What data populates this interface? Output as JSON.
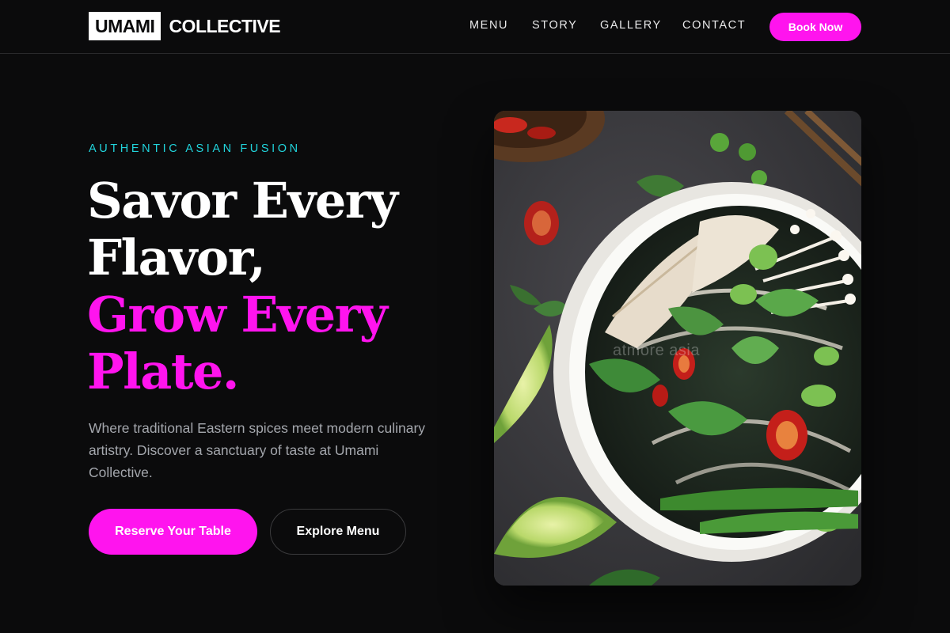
{
  "brand": {
    "box": "UMAMI",
    "text": "COLLECTIVE"
  },
  "nav": {
    "links": [
      "MENU",
      "STORY",
      "GALLERY",
      "CONTACT"
    ],
    "cta": "Book Now"
  },
  "hero": {
    "eyebrow": "AUTHENTIC ASIAN FUSION",
    "headline_line1": "Savor Every",
    "headline_line2": "Flavor,",
    "headline_line3": "Grow Every",
    "headline_line4": "Plate.",
    "subtext": "Where traditional Eastern spices meet modern culinary artistry. Discover a sanctuary of taste at Umami Collective.",
    "primary_button": "Reserve Your Table",
    "secondary_button": "Explore Menu",
    "image_watermark": "atmore asia"
  },
  "colors": {
    "accent": "#ff14ee",
    "eyebrow": "#21d4dc",
    "background": "#0b0b0c"
  }
}
